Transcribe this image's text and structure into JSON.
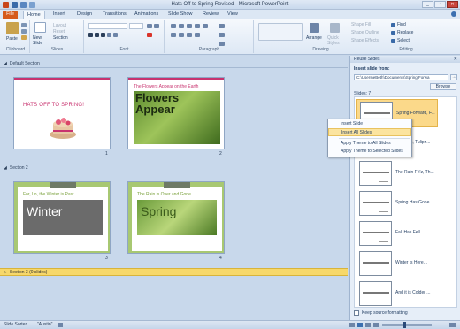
{
  "window": {
    "title": "Hats Off to Spring Revised - Microsoft PowerPoint",
    "buttons": [
      "_",
      "▫",
      "✕"
    ]
  },
  "tabs": [
    "File",
    "Home",
    "Insert",
    "Design",
    "Transitions",
    "Animations",
    "Slide Show",
    "Review",
    "View"
  ],
  "ribbon": {
    "clipboard": {
      "paste": "Paste",
      "label": "Clipboard"
    },
    "slides": {
      "new_slide": "New Slide",
      "layout": "Layout",
      "reset": "Reset",
      "section": "Section",
      "label": "Slides"
    },
    "font": {
      "label": "Font"
    },
    "paragraph": {
      "label": "Paragraph"
    },
    "drawing": {
      "arrange": "Arrange",
      "quick_styles": "Quick Styles",
      "shape_fill": "Shape Fill",
      "shape_outline": "Shape Outline",
      "shape_effects": "Shape Effects",
      "label": "Drawing"
    },
    "editing": {
      "find": "Find",
      "replace": "Replace",
      "select": "Select",
      "label": "Editing"
    }
  },
  "sections": [
    {
      "name": "Default Section"
    },
    {
      "name": "Section 2"
    },
    {
      "name": "Section 3 (0 slides)"
    }
  ],
  "slides": [
    {
      "number": "1",
      "title": "HATS OFF TO SPRING!"
    },
    {
      "number": "2",
      "subtitle": "The Flowers Appear on the Earth",
      "title": "Flowers Appear"
    },
    {
      "number": "3",
      "subtitle": "For, Lo, the Winter is Past",
      "title": "Winter"
    },
    {
      "number": "4",
      "subtitle": "The Rain is Over and Gone",
      "title": "Spring"
    }
  ],
  "reuse_pane": {
    "header": "Reuse Slides",
    "close": "✕",
    "insert_from_label": "Insert slide from:",
    "path": "C:\\Users\\eBeth\\Documents\\Spring Forwa",
    "go": "→",
    "browse": "Browse",
    "slides_count": "Slides: 7",
    "items": [
      {
        "name": "Spring Forward, F...",
        "selected": true
      },
      {
        "name": "Daffodilz, Tulipz...",
        "selected": false
      },
      {
        "name": "The Rain Fri'z, Th...",
        "selected": false
      },
      {
        "name": "Spring Has Gone",
        "selected": false
      },
      {
        "name": "Fall Has Fell",
        "selected": false
      },
      {
        "name": "Winter is Here...",
        "selected": false
      },
      {
        "name": "And it is Colder ...",
        "selected": false
      }
    ],
    "keep_source": "Keep source formatting"
  },
  "context_menu": {
    "items": [
      "Insert Slide",
      "Insert All Slides",
      "Apply Theme to All Slides",
      "Apply Theme to Selected Slides"
    ],
    "highlighted_index": 1
  },
  "status": {
    "view": "Slide Sorter",
    "theme": "\"Austin\"",
    "zoom": "",
    "zoom_level": 0.45
  },
  "colors": {
    "accent_pink": "#c8336f",
    "section_selected": "#f7d86a",
    "green_theme": "#a8c872",
    "file_tab": "#d65a1b"
  }
}
